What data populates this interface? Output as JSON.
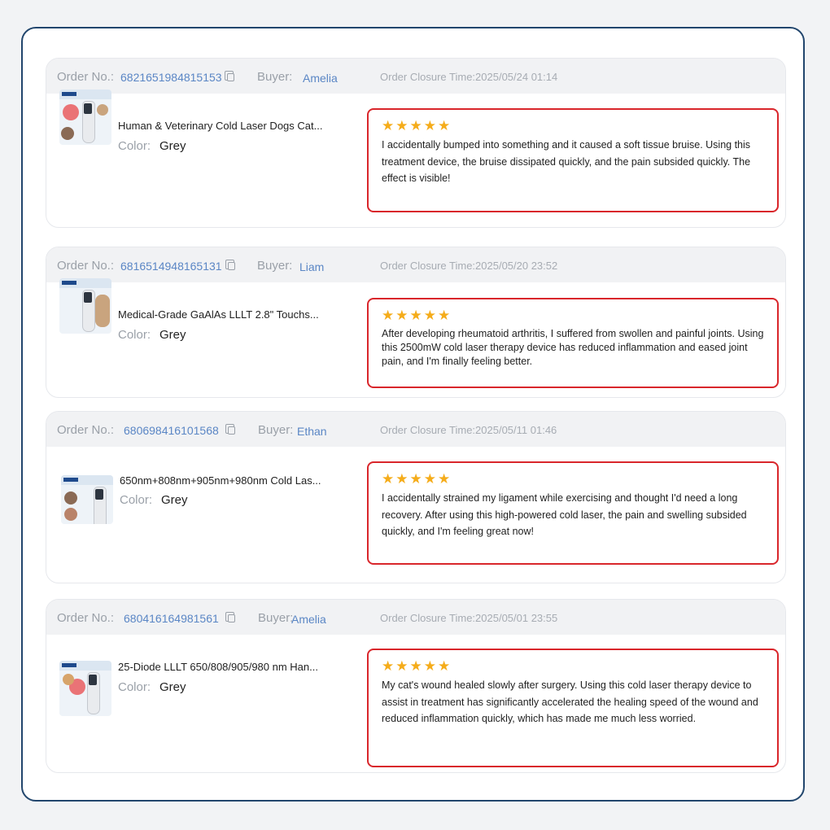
{
  "orders": [
    {
      "order_label": "Order No.:",
      "order_number": "6821651984815153",
      "buyer_label": "Buyer:",
      "buyer_name": "Amelia",
      "closure_time": "Order Closure Time:2025/05/24 01:14",
      "product_title": "Human & Veterinary Cold Laser Dogs Cat...",
      "color_label": "Color:",
      "color_value": "Grey",
      "rating": 5,
      "review": "I accidentally bumped into something and it caused a soft tissue bruise. Using this treatment device, the bruise dissipated quickly, and the pain subsided quickly. The effect is visible!"
    },
    {
      "order_label": "Order No.:",
      "order_number": "6816514948165131",
      "buyer_label": "Buyer:",
      "buyer_name": "Liam",
      "closure_time": "Order Closure Time:2025/05/20 23:52",
      "product_title": "Medical-Grade GaAlAs LLLT 2.8\" Touchs...",
      "color_label": "Color:",
      "color_value": "Grey",
      "rating": 5,
      "review": "After developing rheumatoid arthritis, I suffered from swollen and painful joints. Using this 2500mW cold laser therapy device has reduced inflammation and eased joint pain, and I'm finally feeling better."
    },
    {
      "order_label": "Order No.:",
      "order_number": "680698416101568",
      "buyer_label": "Buyer:",
      "buyer_name": "Ethan",
      "closure_time": "Order Closure Time:2025/05/11 01:46",
      "product_title": "650nm+808nm+905nm+980nm Cold Las...",
      "color_label": "Color:",
      "color_value": "Grey",
      "rating": 5,
      "review": "I accidentally strained my ligament while exercising and thought I'd need a long recovery. After using this high-powered cold laser, the pain and swelling subsided quickly, and I'm feeling great now!"
    },
    {
      "order_label": "Order No.:",
      "order_number": "680416164981561",
      "buyer_label": "Buyer:",
      "buyer_name": "Amelia",
      "closure_time": "Order Closure Time:2025/05/01 23:55",
      "product_title": "25-Diode LLLT 650/808/905/980 nm Han...",
      "color_label": "Color:",
      "color_value": "Grey",
      "rating": 5,
      "review": "My cat's wound healed slowly after surgery. Using this cold laser therapy device to assist in treatment has significantly accelerated the healing speed of the wound and reduced inflammation quickly, which has made me much less worried."
    }
  ],
  "colors": {
    "accent_link": "#5a86c5",
    "review_border": "#d9262b",
    "star": "#f5ac1a",
    "frame_border": "#22466d"
  },
  "icons": {
    "copy": "copy-icon",
    "star": "star-icon"
  }
}
